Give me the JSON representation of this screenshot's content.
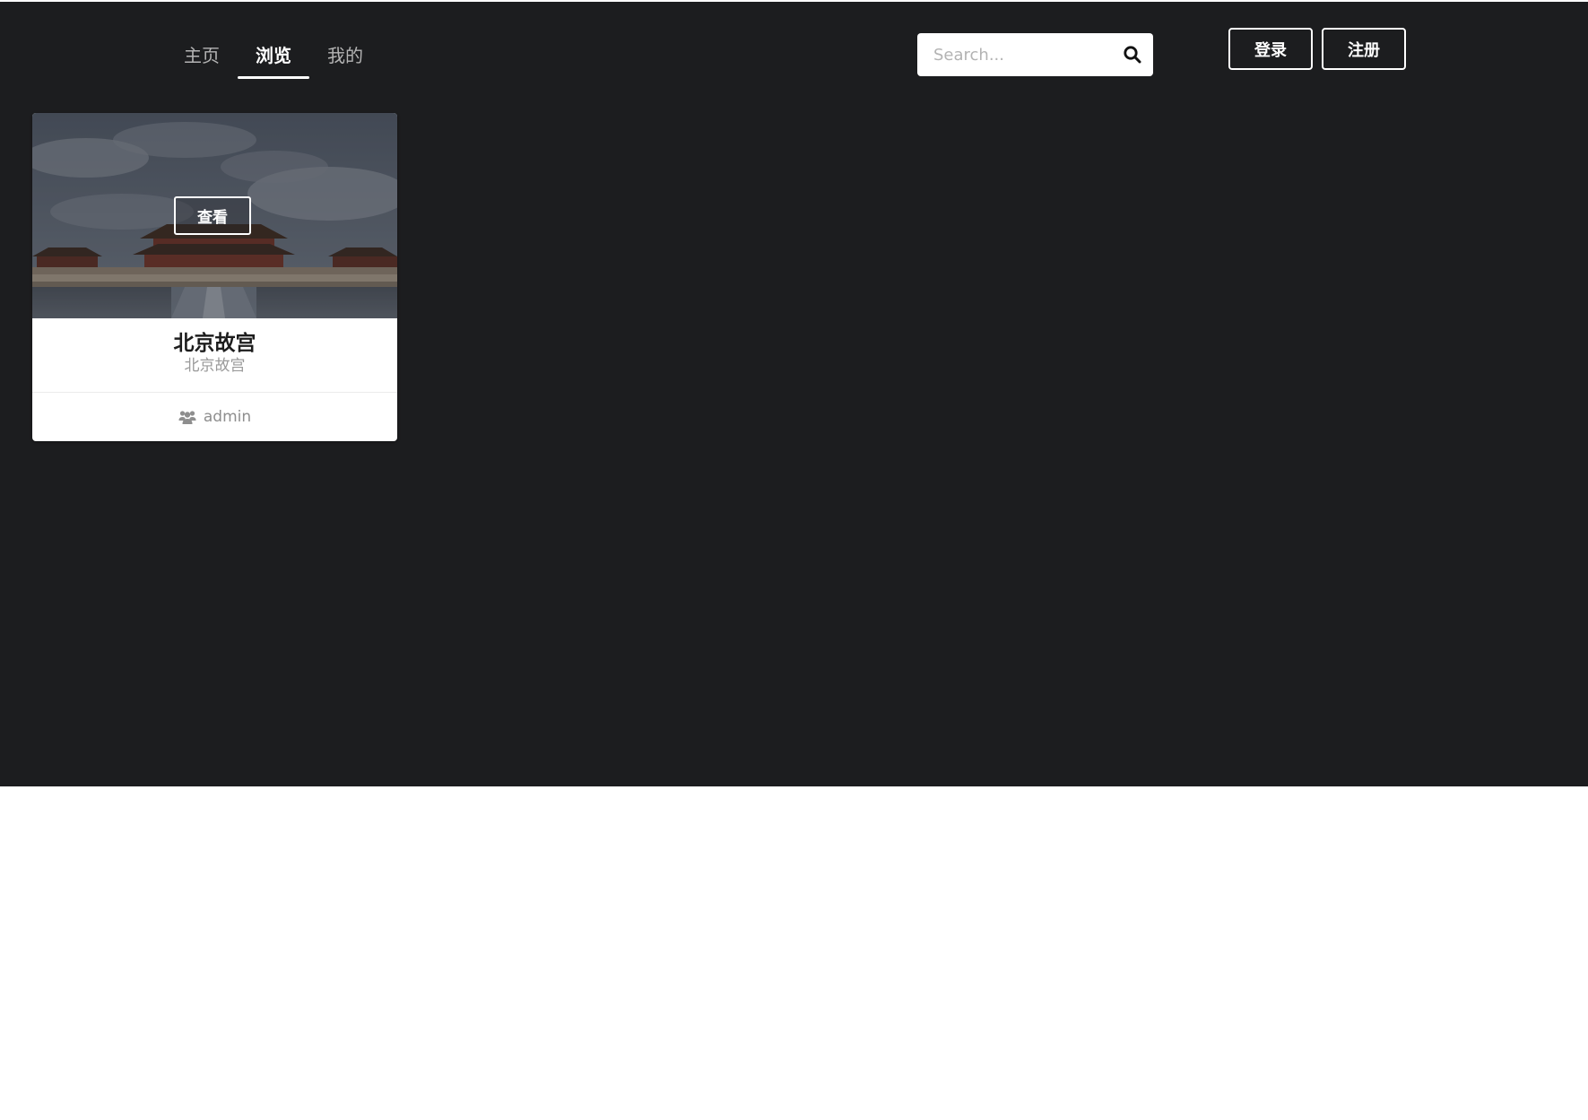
{
  "nav": {
    "tabs": [
      {
        "label": "主页",
        "active": false
      },
      {
        "label": "浏览",
        "active": true
      },
      {
        "label": "我的",
        "active": false
      }
    ]
  },
  "search": {
    "placeholder": "Search...",
    "icon": "search-icon"
  },
  "auth": {
    "login_label": "登录",
    "register_label": "注册"
  },
  "card": {
    "image": "forbidden-city-photo",
    "view_label": "查看",
    "title": "北京故宫",
    "subtitle": "北京故宫",
    "author_icon": "users-icon",
    "author": "admin"
  },
  "colors": {
    "background": "#1c1d1f",
    "accent": "#ffffff",
    "muted_text": "#9a9a9a"
  }
}
